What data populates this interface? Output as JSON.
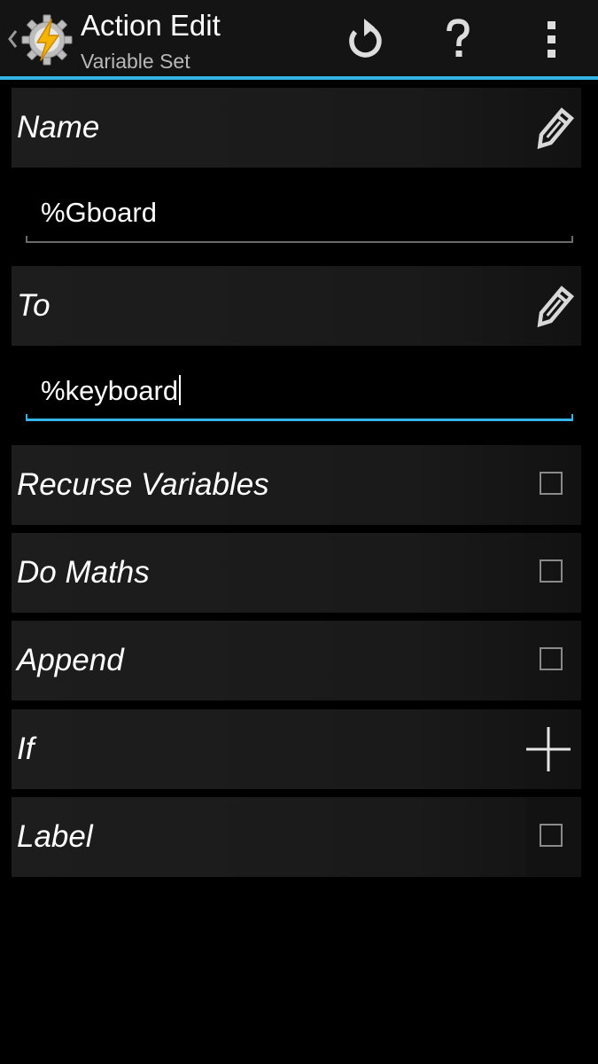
{
  "actionbar": {
    "title": "Action Edit",
    "subtitle": "Variable Set",
    "app_icon": "tasker-gear-lightning-icon",
    "buttons": [
      {
        "name": "undo",
        "icon": "undo-icon"
      },
      {
        "name": "help",
        "icon": "help-icon"
      },
      {
        "name": "overflow",
        "icon": "overflow-menu-icon"
      }
    ]
  },
  "colors": {
    "accent": "#33b5e5",
    "background": "#000000",
    "row_background": "#1b1b1b",
    "icon_lightning": "#f4b400"
  },
  "fields": {
    "name": {
      "label": "Name",
      "value": "%Gboard",
      "icon": "edit-pencil-icon"
    },
    "to": {
      "label": "To",
      "value": "%keyboard",
      "icon": "edit-pencil-icon",
      "focused": true
    }
  },
  "options": [
    {
      "label": "Recurse Variables",
      "checked": false
    },
    {
      "label": "Do Maths",
      "checked": false
    },
    {
      "label": "Append",
      "checked": false
    }
  ],
  "if_row": {
    "label": "If",
    "icon": "add-plus-icon"
  },
  "label_row": {
    "label": "Label",
    "checked": false
  }
}
